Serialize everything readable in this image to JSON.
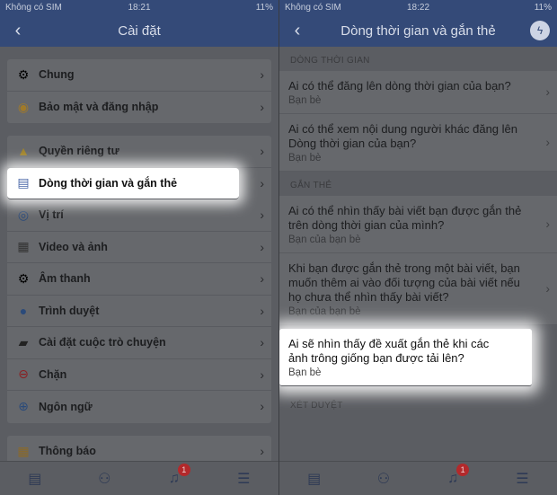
{
  "left": {
    "status": {
      "carrier": "Không có SIM",
      "time": "18:21",
      "battery": "11%"
    },
    "title": "Cài đặt",
    "groups": [
      [
        {
          "label": "Chung",
          "icon": "gear-icon",
          "glyph": "⚙"
        },
        {
          "label": "Bảo mật và đăng nhập",
          "icon": "badge-icon",
          "glyph": "◉"
        }
      ],
      [
        {
          "label": "Quyền riêng tư",
          "icon": "lock-icon",
          "glyph": "▲"
        },
        {
          "label": "Dòng thời gian và gắn thẻ",
          "icon": "timeline-icon",
          "glyph": "▤"
        },
        {
          "label": "Vị trí",
          "icon": "compass-icon",
          "glyph": "◎"
        },
        {
          "label": "Video và ảnh",
          "icon": "film-icon",
          "glyph": "▦"
        },
        {
          "label": "Âm thanh",
          "icon": "gear-icon",
          "glyph": "⚙"
        },
        {
          "label": "Trình duyệt",
          "icon": "globe-icon",
          "glyph": "●"
        },
        {
          "label": "Cài đặt cuộc trò chuyện",
          "icon": "chat-bubbles-icon",
          "glyph": "▰"
        },
        {
          "label": "Chặn",
          "icon": "block-icon",
          "glyph": "⊖"
        },
        {
          "label": "Ngôn ngữ",
          "icon": "globe-icon",
          "glyph": "⊕"
        }
      ],
      [
        {
          "label": "Thông báo",
          "icon": "notification-icon",
          "glyph": "▦"
        }
      ]
    ],
    "badge": "1"
  },
  "right": {
    "status": {
      "carrier": "Không có SIM",
      "time": "18:22",
      "battery": "11%"
    },
    "title": "Dòng thời gian và gắn thẻ",
    "sections": [
      {
        "header": "DÒNG THỜI GIAN",
        "items": [
          {
            "q": "Ai có thể đăng lên dòng thời gian của bạn?",
            "a": "Bạn bè"
          },
          {
            "q": "Ai có thể xem nội dung người khác đăng lên Dòng thời gian của bạn?",
            "a": "Bạn bè"
          }
        ]
      },
      {
        "header": "GẮN THẺ",
        "items": [
          {
            "q": "Ai có thể nhìn thấy bài viết bạn được gắn thẻ trên dòng thời gian của mình?",
            "a": "Bạn của bạn bè"
          },
          {
            "q": "Khi bạn được gắn thẻ trong một bài viết, bạn muốn thêm ai vào đối tượng của bài viết nếu họ chưa thể nhìn thấy bài viết?",
            "a": "Bạn của bạn bè"
          },
          {
            "q": "Ai sẽ nhìn thấy đề xuất gắn thẻ khi các ảnh trông giống bạn được tải lên?",
            "a": "Bạn bè"
          }
        ]
      },
      {
        "header": "XÉT DUYỆT",
        "items": []
      }
    ],
    "badge": "1"
  }
}
